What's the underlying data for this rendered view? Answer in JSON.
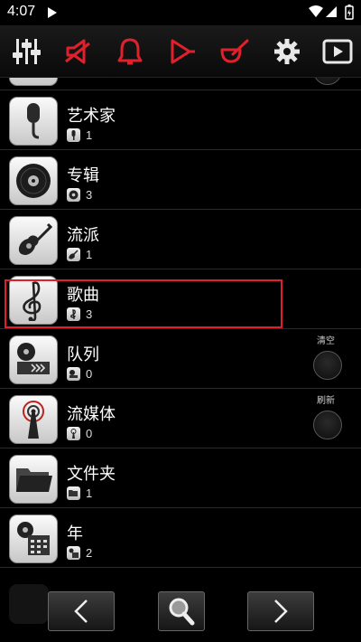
{
  "status": {
    "time": "4:07"
  },
  "toolbar": {
    "icons": [
      "equalizer-icon",
      "speaker-icon",
      "bell-icon",
      "play-outline-icon",
      "mortar-icon",
      "gear-icon",
      "play-box-icon"
    ],
    "accent": "#e0202a"
  },
  "list": {
    "items": [
      {
        "title": "艺术家",
        "count": "1",
        "icon": "microphone-icon",
        "mini_icon": "microphone-mini-icon"
      },
      {
        "title": "专辑",
        "count": "3",
        "icon": "disc-icon",
        "mini_icon": "disc-mini-icon"
      },
      {
        "title": "流派",
        "count": "1",
        "icon": "guitar-icon",
        "mini_icon": "guitar-mini-icon"
      },
      {
        "title": "歌曲",
        "count": "3",
        "icon": "treble-clef-icon",
        "mini_icon": "treble-clef-mini-icon"
      },
      {
        "title": "队列",
        "count": "0",
        "icon": "queue-icon",
        "mini_icon": "queue-mini-icon"
      },
      {
        "title": "流媒体",
        "count": "0",
        "icon": "antenna-icon",
        "mini_icon": "antenna-mini-icon"
      },
      {
        "title": "文件夹",
        "count": "1",
        "icon": "folder-icon",
        "mini_icon": "folder-mini-icon"
      },
      {
        "title": "年",
        "count": "2",
        "icon": "calendar-icon",
        "mini_icon": "calendar-mini-icon"
      }
    ],
    "queue_action": "清空",
    "stream_action": "刷新"
  },
  "bottombar": {
    "icons": [
      "back-arrow-icon",
      "search-icon",
      "forward-arrow-icon"
    ]
  }
}
